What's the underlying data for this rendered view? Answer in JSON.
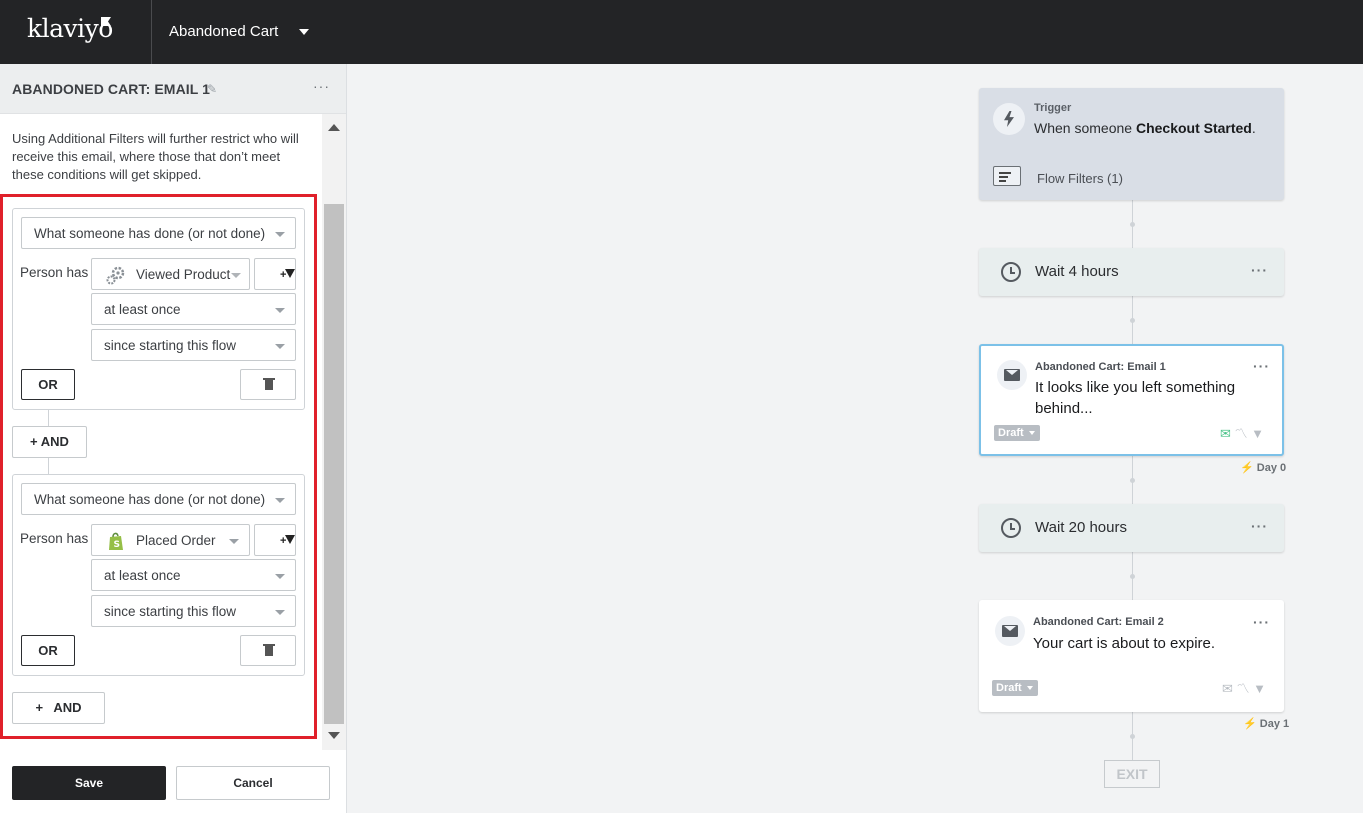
{
  "topbar": {
    "logo": "klaviyo",
    "flow_name": "Abandoned Cart"
  },
  "panel": {
    "title": "ABANDONED CART: EMAIL 1",
    "more": "···",
    "info_text": "Using Additional Filters will further restrict who will receive this email, where those that don’t meet these conditions will get skipped.",
    "conditions": [
      {
        "type": "What someone has done (or not done)",
        "person_has": "Person has",
        "metric": "Viewed Product",
        "metric_icon": "gear-icon",
        "frequency": "at least once",
        "timeframe": "since starting this flow",
        "or_label": "OR"
      },
      {
        "type": "What someone has done (or not done)",
        "person_has": "Person has",
        "metric": "Placed Order",
        "metric_icon": "shopify-bag-icon",
        "frequency": "at least once",
        "timeframe": "since starting this flow",
        "or_label": "OR"
      }
    ],
    "and_label": "+ AND",
    "and_label_bottom": "+   AND",
    "save_label": "Save",
    "cancel_label": "Cancel"
  },
  "flow": {
    "trigger": {
      "label": "Trigger",
      "prefix": "When someone ",
      "event": "Checkout Started",
      "suffix": ".",
      "filters": "Flow Filters (1)"
    },
    "wait1": "Wait 4 hours",
    "email1": {
      "label": "Abandoned Cart: Email 1",
      "subject": "It looks like you left something behind...",
      "status": "Draft",
      "day": "Day 0"
    },
    "wait2": "Wait 20 hours",
    "email2": {
      "label": "Abandoned Cart: Email 2",
      "subject": "Your cart is about to expire.",
      "status": "Draft",
      "day": "Day 1"
    },
    "exit": "EXIT"
  },
  "colors": {
    "topbar": "#232426",
    "highlight": "#e0202a",
    "selected_border": "#7cc1e8",
    "shopify_green": "#95bf47"
  }
}
